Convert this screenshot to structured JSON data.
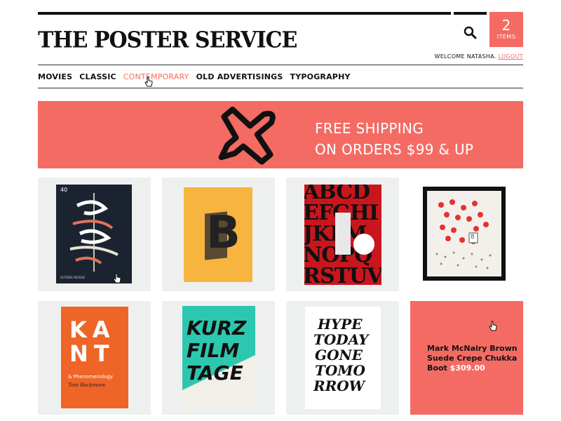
{
  "header": {
    "logo": "THE POSTER SERVICE",
    "cart_count": "2",
    "cart_label": "ITEMS",
    "welcome": "WELCOME NATASHA.",
    "logout": "LOGOUT"
  },
  "nav": {
    "items": [
      "MOVIES",
      "CLASSIC",
      "CONTEMPORARY",
      "OLD ADVERTISINGS",
      "TYPOGRAPHY"
    ],
    "active": "CONTEMPORARY"
  },
  "banner": {
    "line1": "FREE SHIPPING",
    "line2": "ON ORDERS $99 & UP"
  },
  "posters": [
    {
      "number": "40",
      "caption": "OUTSIDE REVIEW"
    },
    {
      "letter": "B"
    },
    {
      "letters": "ABCDEFGHIJKLMNOPQRSTUVWXYZ"
    },
    {
      "badge": "8"
    },
    {
      "title_line1": "KA",
      "title_line2": "NT",
      "subtitle": "& Phenomenology",
      "author": "Tom Rockmore"
    },
    {
      "line1": "KURZ",
      "line2": "FILM",
      "line3": "TAGE"
    },
    {
      "line1": "HYPE",
      "line2": "TODAY",
      "line3": "GONE",
      "line4": "TOMO",
      "line5": "RROW"
    },
    {}
  ],
  "product": {
    "name": "Mark McNairy Brown Suede Crepe Chukka Boot",
    "price": "$309.00"
  },
  "colors": {
    "accent": "#f46b63",
    "tile_bg": "#eef0f0"
  }
}
